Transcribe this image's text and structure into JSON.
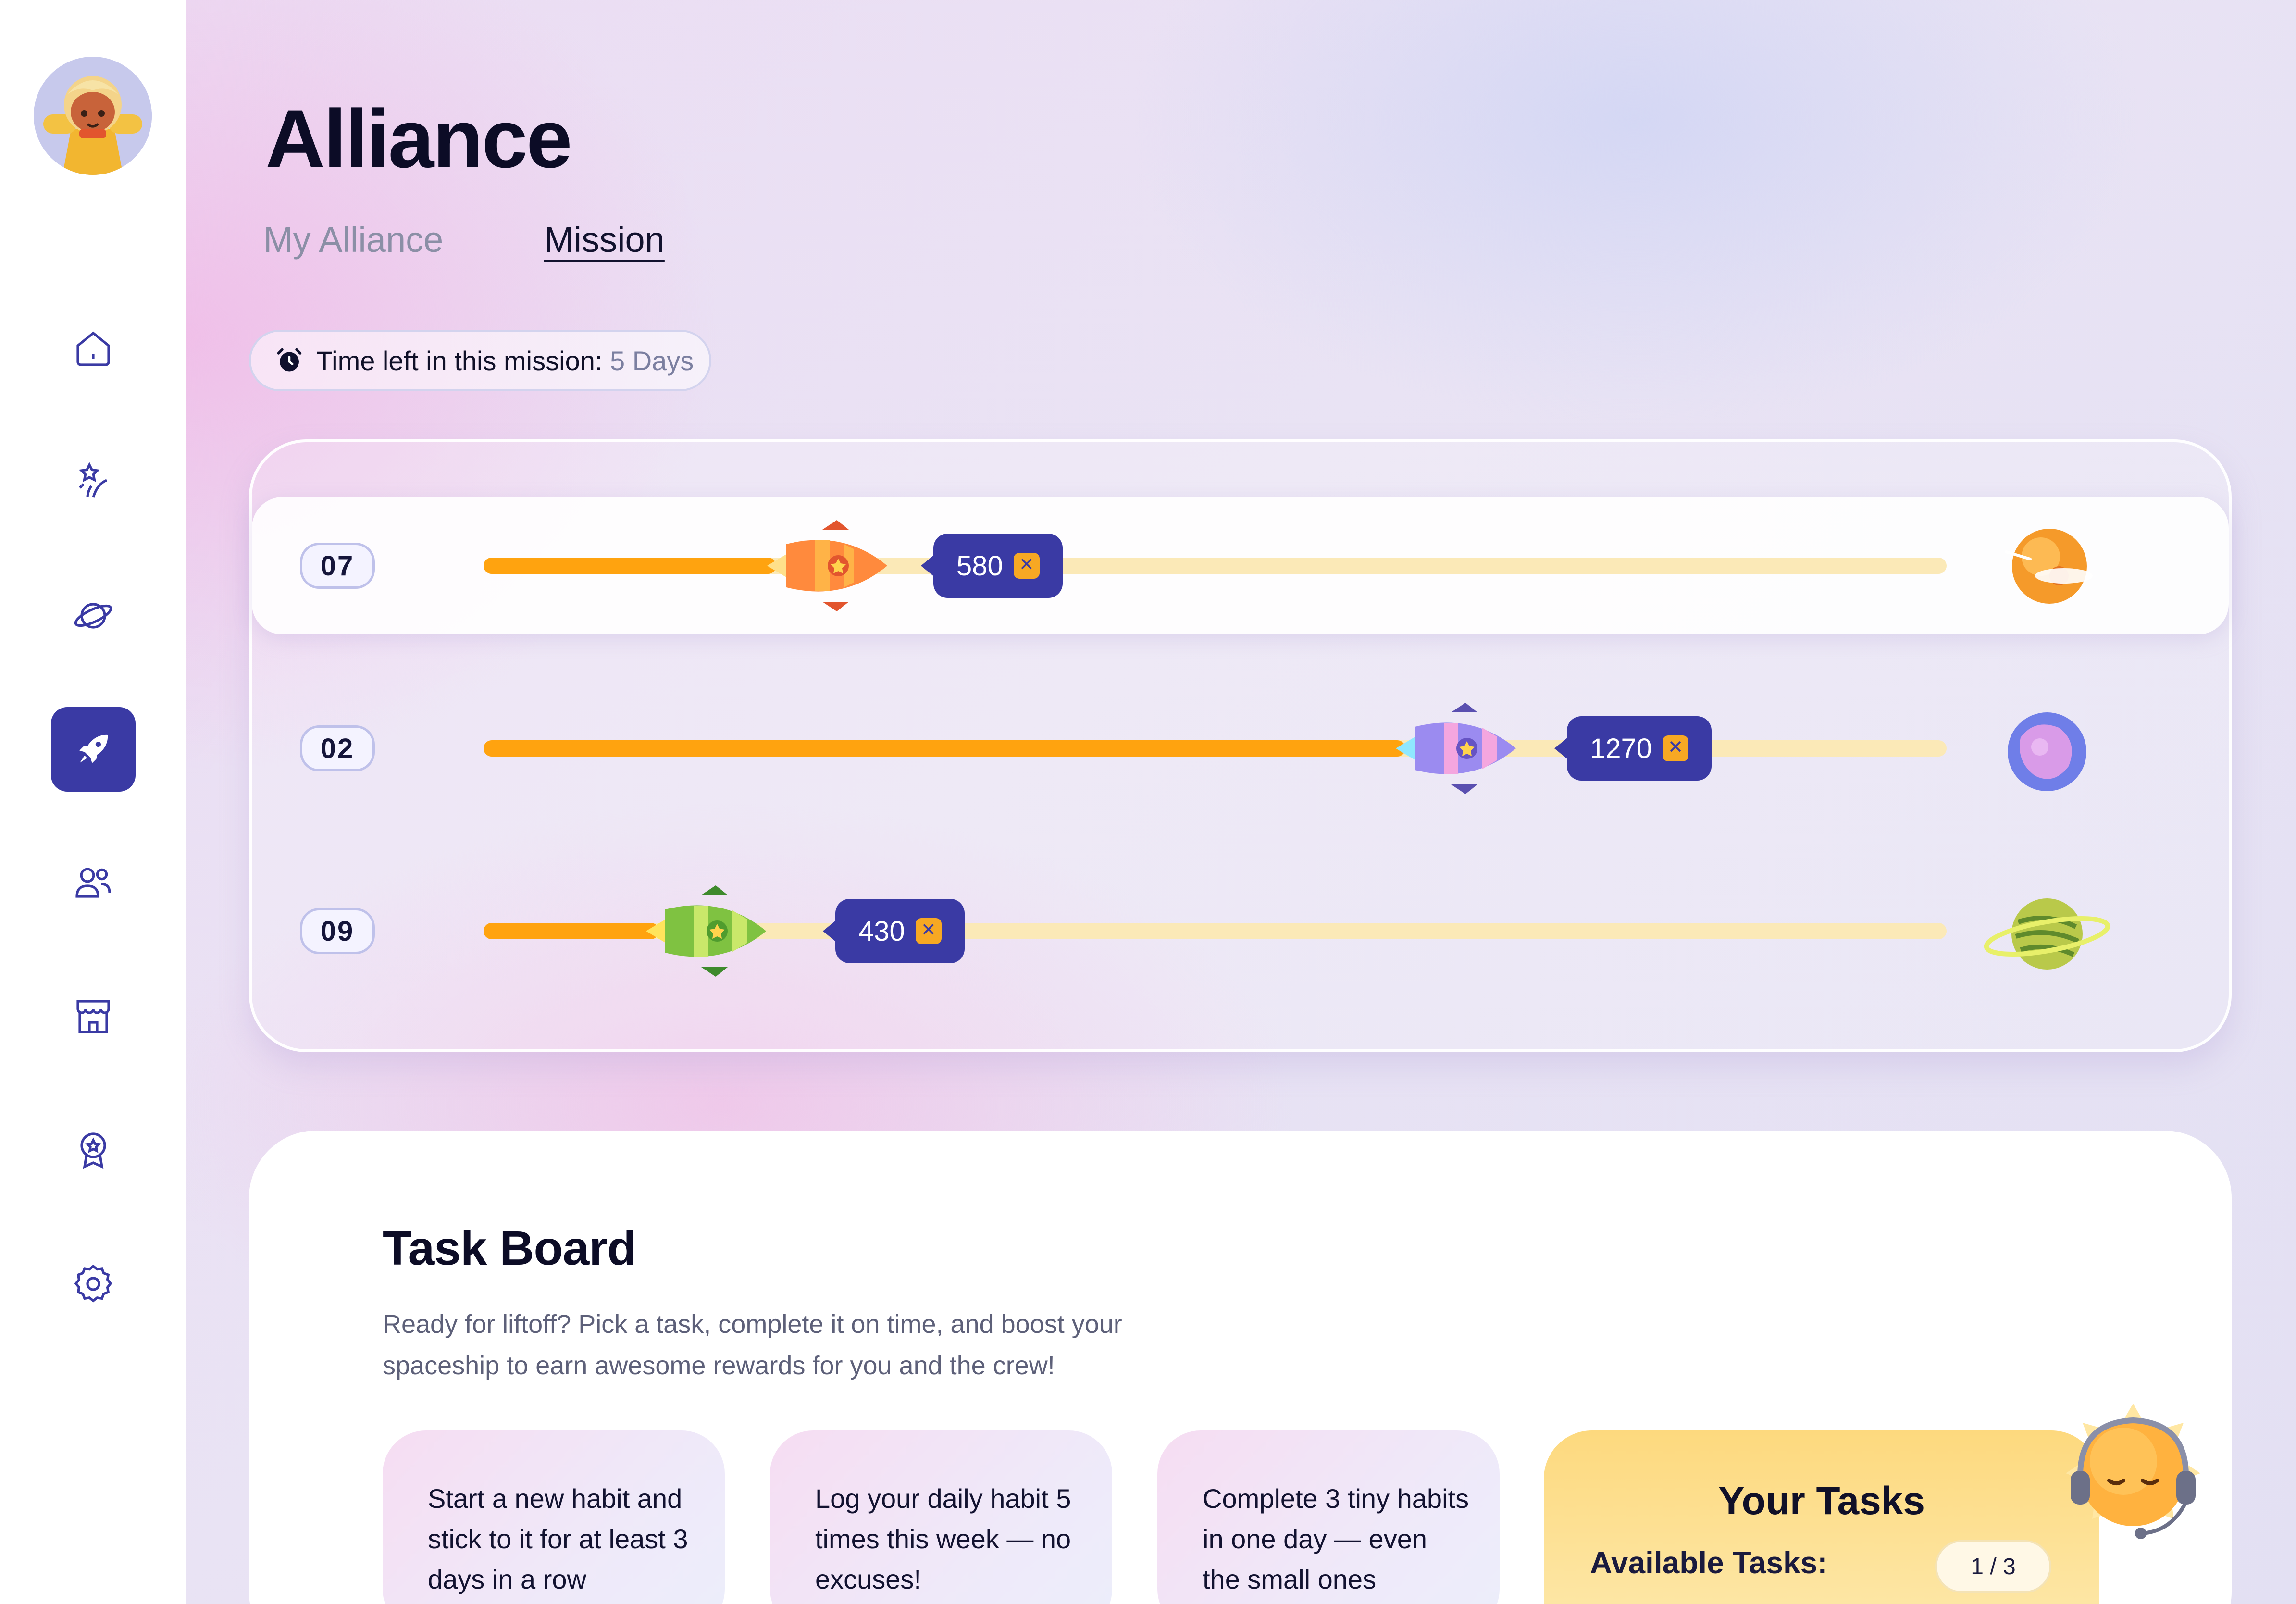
{
  "header": {
    "title": "Alliance"
  },
  "tabs": [
    {
      "label": "My Alliance",
      "active": false
    },
    {
      "label": "Mission",
      "active": true
    }
  ],
  "sidebar": {
    "items": [
      {
        "icon": "home-icon"
      },
      {
        "icon": "sparkle-icon"
      },
      {
        "icon": "planet-icon"
      },
      {
        "icon": "rocket-icon",
        "active": true
      },
      {
        "icon": "users-icon"
      },
      {
        "icon": "shop-icon"
      },
      {
        "icon": "badge-icon"
      },
      {
        "icon": "settings-icon"
      }
    ]
  },
  "mission": {
    "timer_label": "Time left in this mission:",
    "timer_value": "5 Days",
    "teams": [
      {
        "rank": "07",
        "points": "580",
        "progress": 0.2,
        "highlighted": true,
        "ship_color": "#ff7a3d",
        "planet": "sun-planet"
      },
      {
        "rank": "02",
        "points": "1270",
        "progress": 0.63,
        "highlighted": false,
        "ship_color": "#8a7be8",
        "planet": "purple-planet"
      },
      {
        "rank": "09",
        "points": "430",
        "progress": 0.12,
        "highlighted": false,
        "ship_color": "#7fc241",
        "planet": "green-ringed-planet"
      }
    ]
  },
  "task_board": {
    "title": "Task Board",
    "description": "Ready for liftoff? Pick a task, complete it on time, and boost your spaceship to earn awesome rewards for you and the crew!",
    "cards": [
      "Start a new habit and stick to it for at least 3 days in a row",
      "Log your daily habit 5 times this week — no excuses!",
      "Complete 3 tiny habits in one day — even the small ones"
    ],
    "your_tasks": {
      "title": "Your Tasks",
      "available_label": "Available Tasks:",
      "count": "1 / 3"
    }
  },
  "colors": {
    "accent": "#3a3aa4",
    "progress": "#ffa30f",
    "track": "#fbe9b7"
  }
}
